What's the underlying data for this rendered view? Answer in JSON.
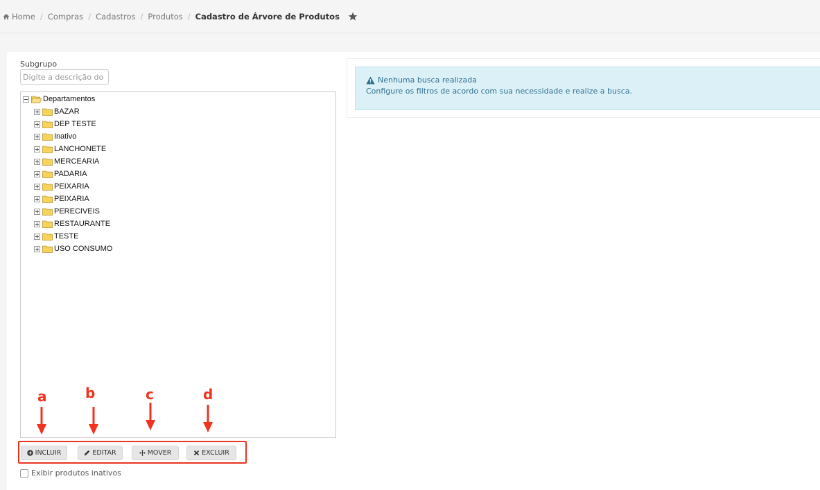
{
  "breadcrumb": {
    "home": "Home",
    "items": [
      "Compras",
      "Cadastros",
      "Produtos"
    ],
    "current": "Cadastro de Árvore de Produtos"
  },
  "filter": {
    "label": "Subgrupo",
    "placeholder": "Digite a descrição do sub"
  },
  "tree": {
    "root": "Departamentos",
    "children": [
      "BAZAR",
      "DEP TESTE",
      "Inativo",
      "LANCHONETE",
      "MERCEARIA",
      "PADARIA",
      "PEIXARIA",
      "PEIXARIA",
      "PERECIVEIS",
      "RESTAURANTE",
      "TESTE",
      "USO CONSUMO"
    ]
  },
  "annotations": [
    "a",
    "b",
    "c",
    "d"
  ],
  "actions": {
    "include": "INCLUIR",
    "edit": "EDITAR",
    "move": "MOVER",
    "delete": "EXCLUIR"
  },
  "show_inactive_label": "Exibir produtos inativos",
  "alert": {
    "title": "Nenhuma busca realizada",
    "message": "Configure os filtros de acordo com sua necessidade e realize a busca."
  },
  "colors": {
    "annotation_red": "#e8331f",
    "alert_bg": "#dbf0f7",
    "alert_text": "#31708f",
    "folder_yellow": "#f7d35c"
  }
}
